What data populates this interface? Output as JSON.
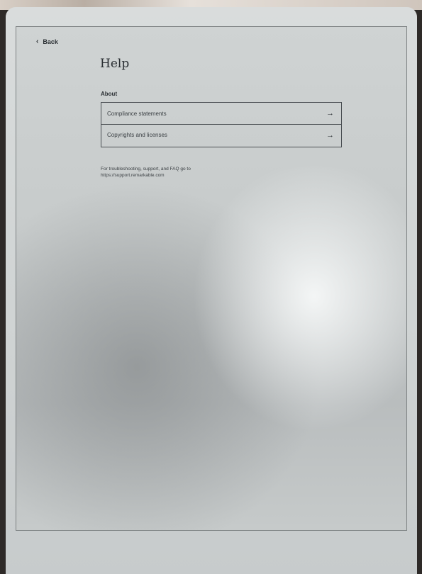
{
  "nav": {
    "back_label": "Back"
  },
  "page": {
    "title": "Help",
    "section_label": "About"
  },
  "items": [
    {
      "label": "Compliance statements",
      "arrow": "→"
    },
    {
      "label": "Copyrights and licenses",
      "arrow": "→"
    }
  ],
  "support": {
    "line1": "For troubleshooting, support, and FAQ go to",
    "link": "https://support.remarkable.com"
  },
  "icons": {
    "back": "chevron-left-icon",
    "item_arrow": "arrow-right-icon"
  }
}
